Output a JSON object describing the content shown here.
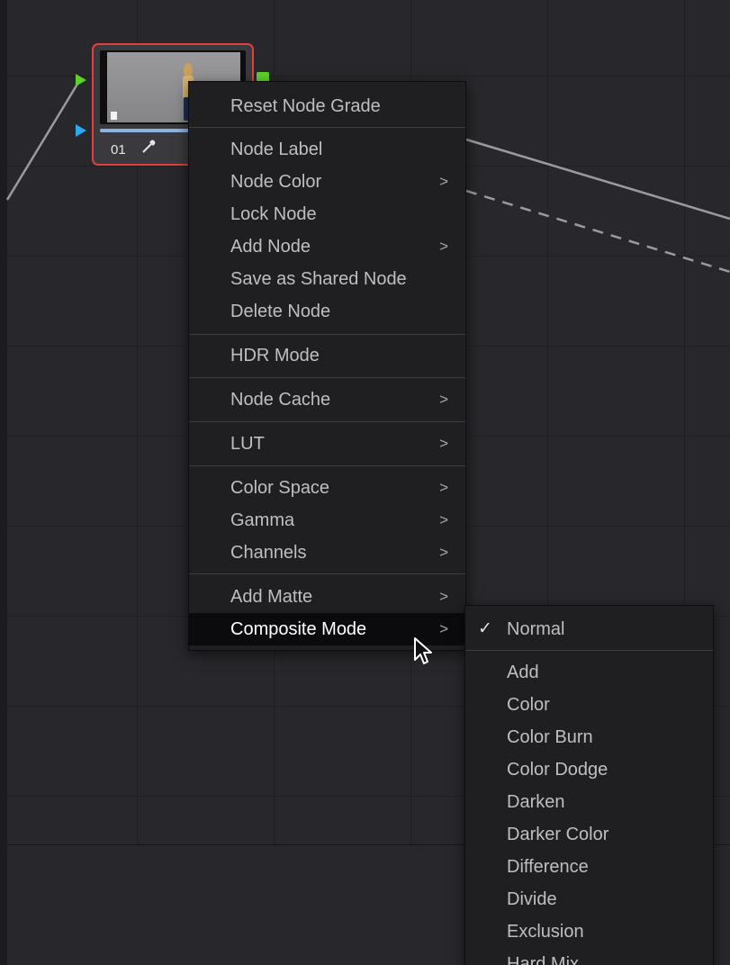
{
  "node": {
    "number": "01",
    "picker_icon": "eyedropper-icon",
    "colors": {
      "selected_border": "#e2413b",
      "rgb_port": "#5ed02a",
      "key_port": "#2aa8f0",
      "progress": "#8cb4e2"
    }
  },
  "context_menu": {
    "reset_node_grade": "Reset Node Grade",
    "node_label": "Node Label",
    "node_color": "Node Color",
    "lock_node": "Lock Node",
    "add_node": "Add Node",
    "save_as_shared_node": "Save as Shared Node",
    "delete_node": "Delete Node",
    "hdr_mode": "HDR Mode",
    "node_cache": "Node Cache",
    "lut": "LUT",
    "color_space": "Color Space",
    "gamma": "Gamma",
    "channels": "Channels",
    "add_matte": "Add Matte",
    "composite_mode": "Composite Mode",
    "submenu_arrow": ">"
  },
  "composite_submenu": {
    "check_mark": "✓",
    "selected": "Normal",
    "items": [
      "Add",
      "Color",
      "Color Burn",
      "Color Dodge",
      "Darken",
      "Darker Color",
      "Difference",
      "Divide",
      "Exclusion",
      "Hard Mix"
    ]
  }
}
